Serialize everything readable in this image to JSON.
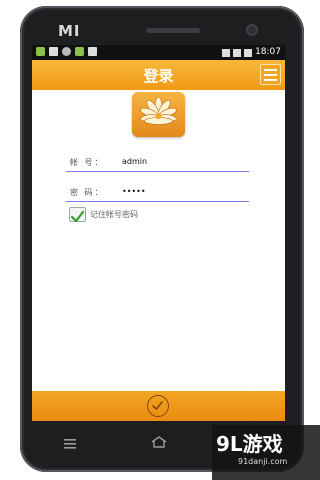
{
  "device": {
    "brand": "MI"
  },
  "status_bar": {
    "time": "18:07"
  },
  "header": {
    "title": "登录"
  },
  "form": {
    "account_label": "帐 号：",
    "account_value": "admin",
    "password_label": "密 码：",
    "password_value": "•••••",
    "remember_label": "记住帐号密码",
    "remember_checked": true
  },
  "watermark": {
    "main": "9L游戏",
    "sub": "91danji.com"
  },
  "colors": {
    "accent": "#f3a526",
    "underline": "#7b7ef0",
    "check": "#3a9a2a"
  }
}
